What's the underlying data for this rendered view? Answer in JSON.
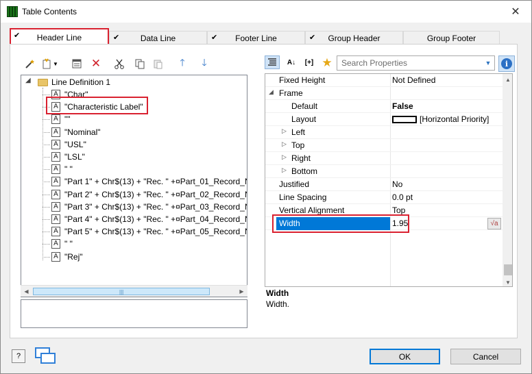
{
  "window": {
    "title": "Table Contents",
    "close_label": "✕"
  },
  "tabs": [
    {
      "label": "Header Line",
      "checked": true,
      "active": true
    },
    {
      "label": "Data Line",
      "checked": true,
      "active": false
    },
    {
      "label": "Footer Line",
      "checked": true,
      "active": false
    },
    {
      "label": "Group Header",
      "checked": true,
      "active": false
    },
    {
      "label": "Group Footer",
      "checked": false,
      "active": false
    }
  ],
  "left_toolbar": {
    "icons": [
      "magic-wand-icon",
      "new-item-icon",
      "dropdown-arrow-icon",
      "properties-icon",
      "delete-icon",
      "cut-icon",
      "copy-icon",
      "paste-icon",
      "move-up-icon",
      "move-down-icon"
    ]
  },
  "tree": {
    "root": {
      "label": "Line Definition  1",
      "expander": "◢"
    },
    "leaf_glyph": "A",
    "items": [
      "\"Char\"",
      "\"Characteristic Label\"",
      "\"\"",
      "\"Nominal\"",
      "\"USL\"",
      "\"LSL\"",
      "\" \"",
      "\"Part 1\" + Chr$(13) + \"Rec. \" +¤Part_01_Record_Nu",
      "\"Part 2\" + Chr$(13) + \"Rec. \" +¤Part_02_Record_Nu",
      "\"Part 3\" + Chr$(13) + \"Rec. \" +¤Part_03_Record_Nu",
      "\"Part 4\" + Chr$(13) + \"Rec. \" +¤Part_04_Record_Nu",
      "\"Part 5\" + Chr$(13) + \"Rec. \" +¤Part_05_Record_Nu",
      "\" \"",
      "\"Rej\""
    ]
  },
  "right_toolbar": {
    "search_placeholder": "Search Properties",
    "icons": [
      "categorized-icon",
      "sort-az-icon",
      "expand-collapse-icon",
      "favorite-star-icon",
      "info-icon"
    ],
    "expand_label": "[+]",
    "info_label": "i"
  },
  "properties": [
    {
      "name": "Fixed Height",
      "value": "Not Defined",
      "indent": 0,
      "expander": ""
    },
    {
      "name": "Frame",
      "value": "",
      "indent": 0,
      "expander": "◢"
    },
    {
      "name": "Default",
      "value": "False",
      "indent": 1,
      "expander": "",
      "bold": true
    },
    {
      "name": "Layout",
      "value": "[Horizontal Priority]",
      "indent": 1,
      "expander": ""
    },
    {
      "name": "Left",
      "value": "",
      "indent": 1,
      "expander": "▷"
    },
    {
      "name": "Top",
      "value": "",
      "indent": 1,
      "expander": "▷"
    },
    {
      "name": "Right",
      "value": "",
      "indent": 1,
      "expander": "▷"
    },
    {
      "name": "Bottom",
      "value": "",
      "indent": 1,
      "expander": "▷"
    },
    {
      "name": "Justified",
      "value": "No",
      "indent": 0,
      "expander": ""
    },
    {
      "name": "Line Spacing",
      "value": "0.0 pt",
      "indent": 0,
      "expander": ""
    },
    {
      "name": "Vertical Alignment",
      "value": "Top",
      "indent": 0,
      "expander": ""
    },
    {
      "name": "Width",
      "value": "1.95",
      "indent": 0,
      "expander": "",
      "selected": true
    }
  ],
  "formula_button_label": "√a",
  "description": {
    "title": "Width",
    "text": "Width."
  },
  "buttons": {
    "ok": "OK",
    "cancel": "Cancel",
    "help": "?"
  },
  "colors": {
    "highlight": "#d9202f",
    "selection": "#0078d7",
    "accent": "#2b70c5"
  }
}
